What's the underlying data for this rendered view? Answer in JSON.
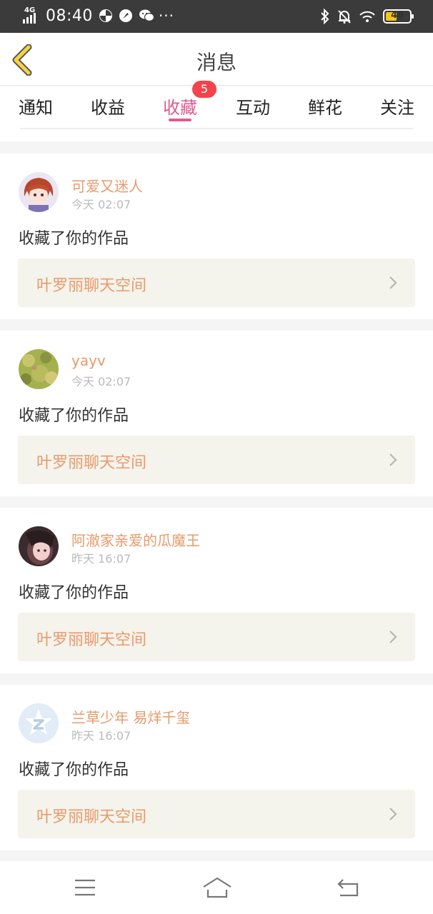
{
  "status_bar": {
    "network": "4G",
    "time": "08:40",
    "more": "···",
    "battery": "48",
    "battery_level": 0.48
  },
  "header": {
    "title": "消息"
  },
  "tabs": {
    "items": [
      {
        "label": "通知"
      },
      {
        "label": "收益"
      },
      {
        "label": "收藏",
        "active": true,
        "badge": "5"
      },
      {
        "label": "互动"
      },
      {
        "label": "鲜花"
      },
      {
        "label": "关注"
      }
    ]
  },
  "messages": [
    {
      "user": "可爱又迷人",
      "time": "今天 02:07",
      "action": "收藏了你的作品",
      "work": "叶罗丽聊天空间",
      "avatar": "anime-girl-avatar"
    },
    {
      "user": "yayv",
      "time": "今天 02:07",
      "action": "收藏了你的作品",
      "work": "叶罗丽聊天空间",
      "avatar": "green-texture-avatar"
    },
    {
      "user": "阿澈家亲爱的瓜魔王",
      "time": "昨天 16:07",
      "action": "收藏了你的作品",
      "work": "叶罗丽聊天空间",
      "avatar": "girl-photo-avatar"
    },
    {
      "user": "兰草少年 易烊千玺",
      "time": "昨天 16:07",
      "action": "收藏了你的作品",
      "work": "叶罗丽聊天空间",
      "avatar": "qzone-default-avatar"
    }
  ],
  "colors": {
    "accent": "#e05a8f",
    "username": "#e89a6b",
    "badge": "#f5434b",
    "work_bg": "#f4f3ec",
    "back_arrow": "#f5d442"
  }
}
